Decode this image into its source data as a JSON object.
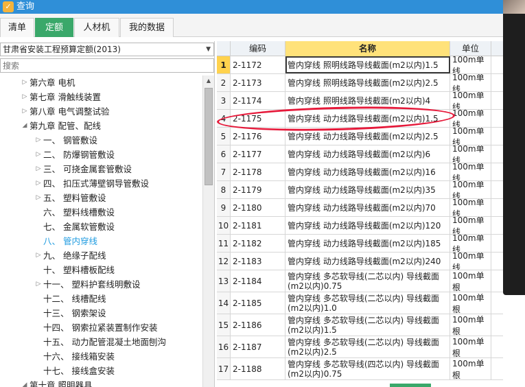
{
  "window": {
    "title": "查询",
    "icon": "query-app-icon"
  },
  "tabs": [
    {
      "label": "清单",
      "active": false
    },
    {
      "label": "定额",
      "active": true
    },
    {
      "label": "人材机",
      "active": false
    },
    {
      "label": "我的数据",
      "active": false
    }
  ],
  "left": {
    "selector_value": "甘肃省安装工程预算定额(2013)",
    "search_placeholder": "搜索",
    "tree": [
      {
        "label": "第六章 电机",
        "level": 0,
        "toggle": "collapsed"
      },
      {
        "label": "第七章 滑触线装置",
        "level": 0,
        "toggle": "collapsed"
      },
      {
        "label": "第八章 电气调整试验",
        "level": 0,
        "toggle": "collapsed"
      },
      {
        "label": "第九章 配管、配线",
        "level": 0,
        "toggle": "expanded"
      },
      {
        "label": "一、 钢管敷设",
        "level": 1,
        "toggle": "collapsed"
      },
      {
        "label": "二、 防爆钢管敷设",
        "level": 1,
        "toggle": "collapsed"
      },
      {
        "label": "三、 可挠金属套管敷设",
        "level": 1,
        "toggle": "collapsed"
      },
      {
        "label": "四、 扣压式薄壁钢导管敷设",
        "level": 1,
        "toggle": "collapsed"
      },
      {
        "label": "五、 塑料管敷设",
        "level": 1,
        "toggle": "collapsed"
      },
      {
        "label": "六、 塑料线槽敷设",
        "level": 1,
        "toggle": "none"
      },
      {
        "label": "七、 金属软管敷设",
        "level": 1,
        "toggle": "none"
      },
      {
        "label": "八、 管内穿线",
        "level": 1,
        "toggle": "none",
        "selected": true
      },
      {
        "label": "九、 绝缘子配线",
        "level": 1,
        "toggle": "collapsed"
      },
      {
        "label": "十、 塑料槽板配线",
        "level": 1,
        "toggle": "none"
      },
      {
        "label": "十一、 塑料护套线明敷设",
        "level": 1,
        "toggle": "collapsed"
      },
      {
        "label": "十二、 线槽配线",
        "level": 1,
        "toggle": "none"
      },
      {
        "label": "十三、 钢索架设",
        "level": 1,
        "toggle": "none"
      },
      {
        "label": "十四、 钢索拉紧装置制作安装",
        "level": 1,
        "toggle": "none"
      },
      {
        "label": "十五、 动力配管混凝土地面刨沟",
        "level": 1,
        "toggle": "none"
      },
      {
        "label": "十六、 接线箱安装",
        "level": 1,
        "toggle": "none"
      },
      {
        "label": "十七、 接线盒安装",
        "level": 1,
        "toggle": "none"
      },
      {
        "label": "第十章 照明器具",
        "level": 0,
        "toggle": "expanded"
      }
    ]
  },
  "table": {
    "headers": {
      "index": "",
      "code": "编码",
      "name": "名称",
      "unit": "单位"
    },
    "rows": [
      {
        "no": "1",
        "code": "2-1172",
        "name": "管内穿线 照明线路导线截面(m2以内)1.5",
        "unit": "100m单线",
        "selected": true
      },
      {
        "no": "2",
        "code": "2-1173",
        "name": "管内穿线 照明线路导线截面(m2以内)2.5",
        "unit": "100m单线"
      },
      {
        "no": "3",
        "code": "2-1174",
        "name": "管内穿线 照明线路导线截面(m2以内)4",
        "unit": "100m单线"
      },
      {
        "no": "4",
        "code": "2-1175",
        "name": "管内穿线 动力线路导线截面(m2以内)1.5",
        "unit": "100m单线",
        "circled": true
      },
      {
        "no": "5",
        "code": "2-1176",
        "name": "管内穿线 动力线路导线截面(m2以内)2.5",
        "unit": "100m单线"
      },
      {
        "no": "6",
        "code": "2-1177",
        "name": "管内穿线 动力线路导线截面(m2以内)6",
        "unit": "100m单线"
      },
      {
        "no": "7",
        "code": "2-1178",
        "name": "管内穿线 动力线路导线截面(m2以内)16",
        "unit": "100m单线"
      },
      {
        "no": "8",
        "code": "2-1179",
        "name": "管内穿线 动力线路导线截面(m2以内)35",
        "unit": "100m单线"
      },
      {
        "no": "9",
        "code": "2-1180",
        "name": "管内穿线 动力线路导线截面(m2以内)70",
        "unit": "100m单线"
      },
      {
        "no": "10",
        "code": "2-1181",
        "name": "管内穿线 动力线路导线截面(m2以内)120",
        "unit": "100m单线"
      },
      {
        "no": "11",
        "code": "2-1182",
        "name": "管内穿线 动力线路导线截面(m2以内)185",
        "unit": "100m单线"
      },
      {
        "no": "12",
        "code": "2-1183",
        "name": "管内穿线 动力线路导线截面(m2以内)240",
        "unit": "100m单线"
      },
      {
        "no": "13",
        "code": "2-1184",
        "name": "管内穿线 多芯软导线(二芯以内) 导线截面(m2以内)0.75",
        "unit": "100m单根"
      },
      {
        "no": "14",
        "code": "2-1185",
        "name": "管内穿线 多芯软导线(二芯以内) 导线截面(m2以内)1.0",
        "unit": "100m单根"
      },
      {
        "no": "15",
        "code": "2-1186",
        "name": "管内穿线 多芯软导线(二芯以内) 导线截面(m2以内)1.5",
        "unit": "100m单根"
      },
      {
        "no": "16",
        "code": "2-1187",
        "name": "管内穿线 多芯软导线(二芯以内) 导线截面(m2以内)2.5",
        "unit": "100m单根"
      },
      {
        "no": "17",
        "code": "2-1188",
        "name": "管内穿线 多芯软导线(四芯以内) 导线截面(m2以内)0.75",
        "unit": "100m单根"
      }
    ]
  },
  "colors": {
    "titlebar": "#2f8fd8",
    "active_tab": "#3aa86a",
    "selected_tree_text": "#1e9be0",
    "header_highlight": "#ffe27a",
    "annotation_circle": "#e6193a"
  }
}
